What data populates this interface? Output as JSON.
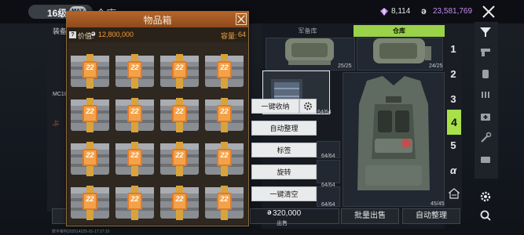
{
  "topbar": {
    "level": "16级",
    "max_badge": "MAX",
    "title": "仓库",
    "gems": "8,114",
    "coin_symbol": "ə",
    "coins": "23,581,769"
  },
  "left": {
    "label": "装备",
    "small_label": "MC18",
    "red_label": "ぶ"
  },
  "dialog": {
    "title": "物品箱",
    "help": "?",
    "value_label": "价值:",
    "coin_symbol": "ə",
    "value": "12,800,000",
    "capacity_label": "容量:",
    "capacity": "64",
    "item_badge": "22"
  },
  "tabs": {
    "armory": "军备库",
    "warehouse": "仓库"
  },
  "slots": {
    "top_left_count": "25/25",
    "top_right_count": "24/25",
    "selected_count": "64/64",
    "count_a": "64/64",
    "count_b": "64/64",
    "count_c": "64/64",
    "vest_count": "45/45"
  },
  "numbers": [
    "1",
    "2",
    "3",
    "4",
    "5",
    "α"
  ],
  "active_number": "4",
  "menu": {
    "collect_all": "一键收纳",
    "auto_sort": "自动整理",
    "tag": "标签",
    "rotate": "旋转",
    "clear_all": "一键清空"
  },
  "bottom": {
    "sell_price_coin": "ə",
    "sell_price": "320,000",
    "sell_label": "出售",
    "batch_sell": "批量出售",
    "auto_sort": "自动整理"
  },
  "footer": "数字审判202514225-01-17:17:10",
  "colors": {
    "accent_green": "#a8e04a",
    "dialog_header": "#b5652a",
    "value_orange": "#f09a3a",
    "coin_purple": "#c48cf0"
  }
}
